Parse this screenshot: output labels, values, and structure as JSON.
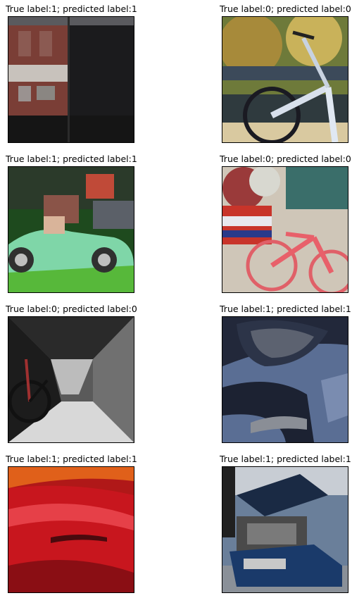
{
  "panels": [
    {
      "title": "True label:1; predicted label:1",
      "true_label": 1,
      "predicted_label": 1,
      "image_subject": "building facade with windows"
    },
    {
      "title": "True label:0; predicted label:0",
      "true_label": 0,
      "predicted_label": 0,
      "image_subject": "white bicycle by railing"
    },
    {
      "title": "True label:1; predicted label:1",
      "true_label": 1,
      "predicted_label": 1,
      "image_subject": "green vintage convertible car"
    },
    {
      "title": "True label:0; predicted label:0",
      "true_label": 0,
      "predicted_label": 0,
      "image_subject": "red bicycle with flowers"
    },
    {
      "title": "True label:0; predicted label:0",
      "true_label": 0,
      "predicted_label": 0,
      "image_subject": "bicycle in grey alley"
    },
    {
      "title": "True label:1; predicted label:1",
      "true_label": 1,
      "predicted_label": 1,
      "image_subject": "car headlight reflection"
    },
    {
      "title": "True label:1; predicted label:1",
      "true_label": 1,
      "predicted_label": 1,
      "image_subject": "red car hood"
    },
    {
      "title": "True label:1; predicted label:1",
      "true_label": 1,
      "predicted_label": 1,
      "image_subject": "blue car with open hood"
    }
  ]
}
